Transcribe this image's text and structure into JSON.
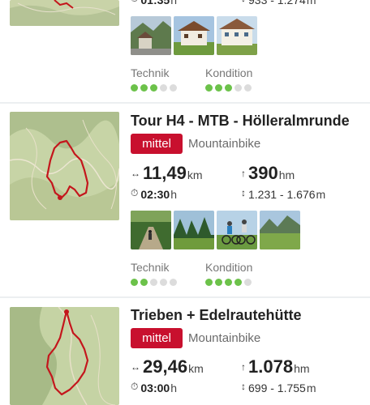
{
  "cards": [
    {
      "duration_icon": "clock-icon",
      "duration": "01:35",
      "duration_unit": "h",
      "altitude_icon": "altitude-range-icon",
      "altitude_range": "933 - 1.274",
      "altitude_unit": "m",
      "technik_label": "Technik",
      "kondition_label": "Kondition",
      "technik_level": 3,
      "kondition_level": 3,
      "photos": [
        "mountain-village-photo",
        "farmhouse-photo",
        "guesthouse-photo"
      ]
    },
    {
      "title": "Tour H4 - MTB - Hölleralmrunde",
      "difficulty": "mittel",
      "sport": "Mountainbike",
      "distance": "11,49",
      "distance_unit": "km",
      "ascent": "390",
      "ascent_unit": "hm",
      "duration": "02:30",
      "duration_unit": "h",
      "altitude_range": "1.231 - 1.676",
      "altitude_unit": "m",
      "technik_label": "Technik",
      "kondition_label": "Kondition",
      "technik_level": 2,
      "kondition_level": 4,
      "photos": [
        "bike-trail-photo",
        "forest-meadow-photo",
        "mountain-bikers-photo",
        "alpine-meadow-photo"
      ]
    },
    {
      "title": "Trieben + Edelrautehütte",
      "difficulty": "mittel",
      "sport": "Mountainbike",
      "distance": "29,46",
      "distance_unit": "km",
      "ascent": "1.078",
      "ascent_unit": "hm",
      "duration": "03:00",
      "duration_unit": "h",
      "altitude_range": "699 - 1.755",
      "altitude_unit": "m"
    }
  ],
  "icons": {
    "distance": "↔",
    "ascent": "↑",
    "duration": "⏱",
    "altitude": "↕"
  },
  "colors": {
    "difficulty_badge": "#c8102e",
    "rating_on": "#6cc24a",
    "rating_off": "#dcdcdc"
  }
}
